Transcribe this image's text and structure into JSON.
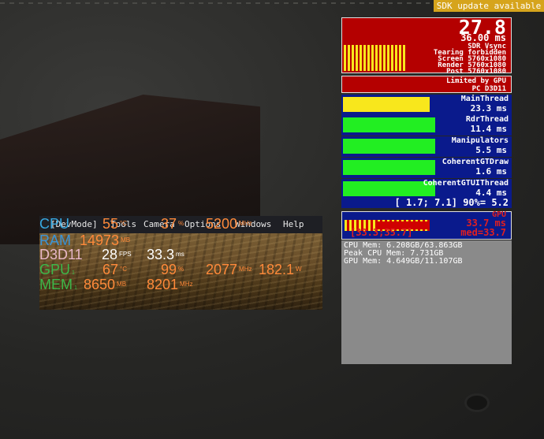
{
  "banner": {
    "text": "SDK update available"
  },
  "fps_panel": {
    "fps": "27.8",
    "ms": "36.00 ms",
    "lines": [
      "SDR Vsync",
      "Tearing forbidden",
      "Screen 5760x1080",
      "Render 5760x1080",
      "Post 5760x1080"
    ]
  },
  "limited_panel": {
    "line1": "Limited by GPU",
    "line2": "PC D3D11"
  },
  "threads": [
    {
      "name": "MainThread",
      "value": "23.3 ms",
      "fill": 0.73,
      "color": "#f8e71c"
    },
    {
      "name": "RdrThread",
      "value": "11.4 ms",
      "fill": 0.78,
      "color": "#22ee22"
    },
    {
      "name": "Manipulators",
      "value": "5.5 ms",
      "fill": 0.78,
      "color": "#22ee22"
    },
    {
      "name": "CoherentGTDraw",
      "value": "1.6 ms",
      "fill": 0.78,
      "color": "#22ee22"
    },
    {
      "name": "CoherentGTUIThread",
      "value": "4.4 ms",
      "fill": 0.78,
      "color": "#22ee22"
    }
  ],
  "range_line": "[ 1.7; 7.1] 90%= 5.2",
  "gpu_panel": {
    "label": "GPU",
    "ms": "33.7 ms",
    "range": "[33.3;35.7]",
    "median": "med=33.7"
  },
  "memory": [
    "CPU Mem: 6.208GB/63.863GB",
    "Peak CPU Mem: 7.731GB",
    "GPU Mem: 4.649GB/11.107GB"
  ],
  "menu": [
    "[DevMode]",
    "Tools",
    "Camera",
    "Options",
    "Windows",
    "Help"
  ],
  "overlay": {
    "cpu": {
      "label": "CPU",
      "temp": "55",
      "temp_unit": "°C",
      "load": "37",
      "load_unit": "%",
      "clock": "5200",
      "clock_unit": "MHz"
    },
    "ram": {
      "label": "RAM",
      "value": "14973",
      "unit": "MB"
    },
    "d3d11": {
      "label": "D3D11",
      "fps": "28",
      "fps_unit": "FPS",
      "frametime": "33.3",
      "frametime_unit": "ms"
    },
    "gpu": {
      "label": "GPU",
      "sub": "1",
      "temp": "67",
      "temp_unit": "°C",
      "load": "99",
      "load_unit": "%",
      "clock": "2077",
      "clock_unit": "MHz",
      "power": "182.1",
      "power_unit": "W"
    },
    "mem": {
      "label": "MEM",
      "sub": "1",
      "value": "8650",
      "unit": "MB",
      "clock": "8201",
      "clock_unit": "MHz"
    }
  }
}
